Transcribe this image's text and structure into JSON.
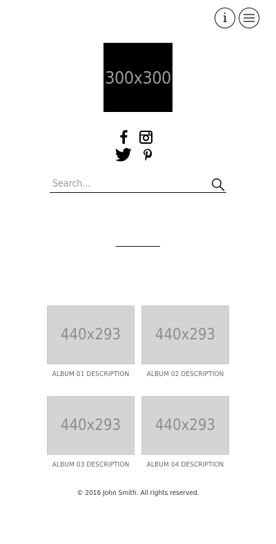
{
  "header": {
    "info_icon": "info-icon",
    "menu_icon": "hamburger-menu-icon"
  },
  "logo": {
    "placeholder_text": "300x300"
  },
  "social": [
    {
      "name": "facebook",
      "icon": "facebook-icon"
    },
    {
      "name": "instagram",
      "icon": "instagram-icon"
    },
    {
      "name": "twitter",
      "icon": "twitter-icon"
    },
    {
      "name": "pinterest",
      "icon": "pinterest-icon"
    }
  ],
  "search": {
    "placeholder": "Search...",
    "value": "",
    "icon": "search-icon"
  },
  "albums": [
    {
      "thumb_text": "440x293",
      "description": "ALBUM 01 DESCRIPTION"
    },
    {
      "thumb_text": "440x293",
      "description": "ALBUM 02 DESCRIPTION"
    },
    {
      "thumb_text": "440x293",
      "description": "ALBUM 03 DESCRIPTION"
    },
    {
      "thumb_text": "440x293",
      "description": "ALBUM 04 DESCRIPTION"
    }
  ],
  "footer": {
    "copyright": "© 2016 John Smith. All rights reserved."
  },
  "colors": {
    "background": "#ffffff",
    "thumb": "#d4d4d4",
    "logo_bg": "#000000"
  }
}
